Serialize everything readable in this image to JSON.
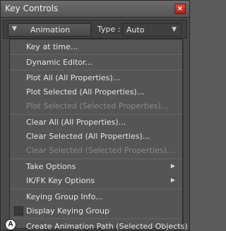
{
  "window": {
    "title": "Key Controls",
    "close_glyph": "×"
  },
  "toolbar": {
    "dropdown_label": "Animation",
    "type_label": "Type :",
    "type_value": "Auto"
  },
  "menu": {
    "key_at_time": "Key at time...",
    "dynamic_editor": "Dynamic Editor...",
    "plot_all": "Plot All (All Properties)...",
    "plot_selected": "Plot Selected (All Properties)...",
    "plot_selected_sel": "Plot Selected (Selected Properties)...",
    "clear_all": "Clear All (All Properties)...",
    "clear_selected": "Clear Selected (All Properties)...",
    "clear_selected_sel": "Clear Selected (Selected Properties)...",
    "take_options": "Take Options",
    "ikfk_key_options": "IK/FK Key Options",
    "keying_group_info": "Keying Group Info...",
    "display_keying_group": "Display Keying Group",
    "create_animation_path": "Create Animation Path (Selected Objects)"
  },
  "callout": {
    "label": "A"
  }
}
